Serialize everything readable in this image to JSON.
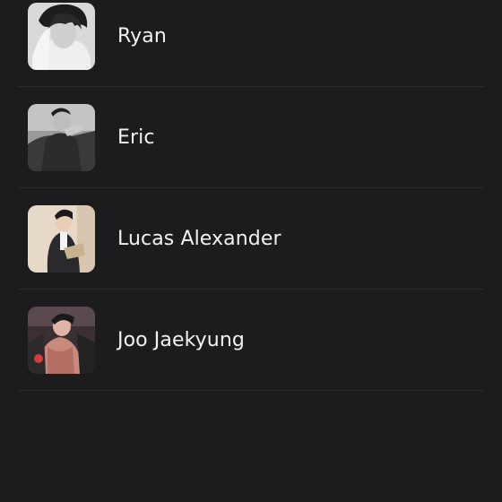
{
  "characters": [
    {
      "name": "Ryan",
      "avatar_icon": "character-portrait"
    },
    {
      "name": "Eric",
      "avatar_icon": "character-portrait"
    },
    {
      "name": "Lucas Alexander",
      "avatar_icon": "character-portrait"
    },
    {
      "name": "Joo Jaekyung",
      "avatar_icon": "character-portrait"
    }
  ],
  "colors": {
    "background": "#1c1c1e",
    "divider": "#2b2b2e",
    "text": "#f2f2f2"
  }
}
